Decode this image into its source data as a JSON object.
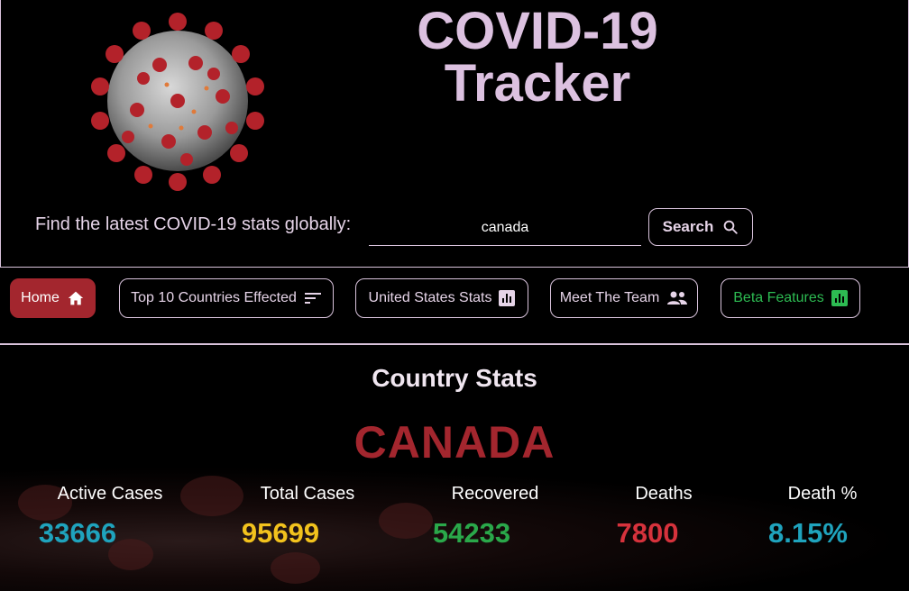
{
  "header": {
    "title_line1": "COVID-19",
    "title_line2": "Tracker",
    "find_label": "Find the latest COVID-19 stats globally:",
    "search_value": "canada",
    "search_button": "Search"
  },
  "nav": {
    "items": [
      {
        "label": "Home",
        "icon": "home-icon"
      },
      {
        "label": "Top 10 Countries Effected",
        "icon": "sort-icon"
      },
      {
        "label": "United States Stats",
        "icon": "bar-chart-icon"
      },
      {
        "label": "Meet The Team",
        "icon": "people-icon"
      },
      {
        "label": "Beta Features",
        "icon": "bar-chart-icon"
      }
    ]
  },
  "main": {
    "section_title": "Country Stats",
    "country": "CANADA",
    "stats": [
      {
        "label": "Active Cases",
        "value": "33666",
        "color": "#1fa3bd"
      },
      {
        "label": "Total Cases",
        "value": "95699",
        "color": "#f2c21d"
      },
      {
        "label": "Recovered",
        "value": "54233",
        "color": "#2aa84a"
      },
      {
        "label": "Deaths",
        "value": "7800",
        "color": "#d6323c"
      },
      {
        "label": "Death %",
        "value": "8.15%",
        "color": "#1fa3bd"
      }
    ]
  },
  "colors": {
    "accent": "#a3262e",
    "title": "#dcc1e0",
    "border": "#d9c3dc"
  }
}
